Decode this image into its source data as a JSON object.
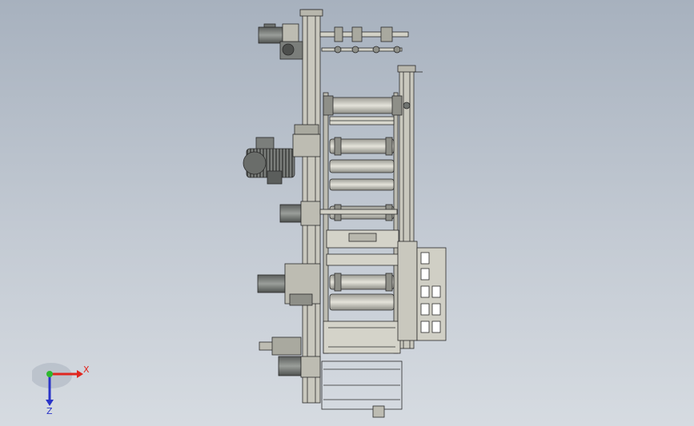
{
  "viewport": {
    "background_top": "#a7b1be",
    "background_bottom": "#d6dbe1"
  },
  "model": {
    "line_color": "#2a2a2a",
    "fill_color": "#c8c7bd",
    "shade_color": "#8e8f88",
    "motor_color": "#6f7370"
  },
  "triad": {
    "x_label": "X",
    "z_label": "Z",
    "x_color": "#e0271f",
    "z_color": "#2a34c8",
    "y_color": "#2eb82e"
  }
}
